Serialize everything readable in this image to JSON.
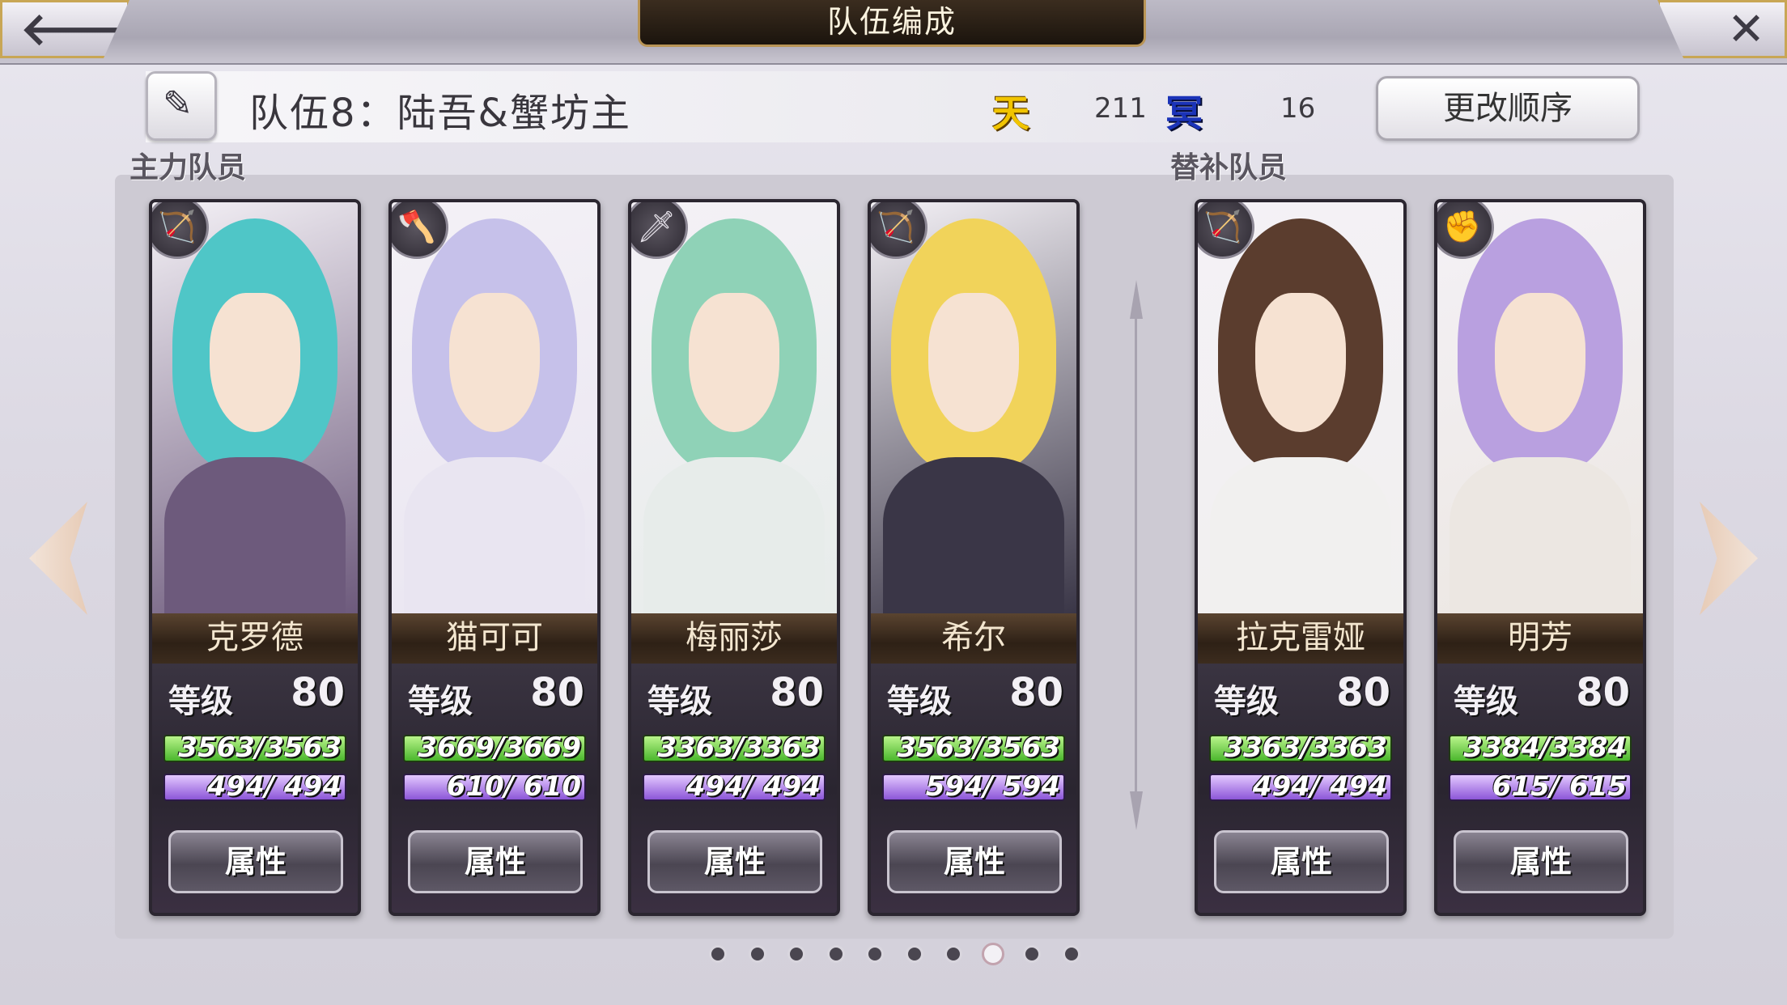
{
  "header": {
    "title": "队伍编成",
    "back_glyph": "🡐",
    "close_glyph": "✕"
  },
  "team": {
    "name": "队伍8：陆吾&蟹坊主",
    "sky_icon_label": "天",
    "sky_value": "211",
    "nether_icon_label": "冥",
    "nether_value": "16",
    "reorder_label": "更改顺序",
    "edit_icon": "pen-icon"
  },
  "sections": {
    "main_label": "主力队员",
    "sub_label": "替补队员"
  },
  "level_label": "等级",
  "attr_label": "属性",
  "characters": [
    {
      "name": "克罗德",
      "level": "80",
      "hp": "3563/3563",
      "mp": "494/ 494",
      "weapon": "bow-icon",
      "weapon_glyph": "🏹",
      "hair": "#4fc6c7",
      "body": "#6d5a7c"
    },
    {
      "name": "猫可可",
      "level": "80",
      "hp": "3669/3669",
      "mp": "610/ 610",
      "weapon": "axe-icon",
      "weapon_glyph": "🪓",
      "hair": "#c6c1ea",
      "body": "#e9e5f1"
    },
    {
      "name": "梅丽莎",
      "level": "80",
      "hp": "3363/3363",
      "mp": "494/ 494",
      "weapon": "sword-icon",
      "weapon_glyph": "🗡",
      "hair": "#8fd2b7",
      "body": "#e7ecea"
    },
    {
      "name": "希尔",
      "level": "80",
      "hp": "3563/3563",
      "mp": "594/ 594",
      "weapon": "bow-icon",
      "weapon_glyph": "🏹",
      "hair": "#f1d35a",
      "body": "#3a3647"
    },
    {
      "name": "拉克雷娅",
      "level": "80",
      "hp": "3363/3363",
      "mp": "494/ 494",
      "weapon": "bow-icon",
      "weapon_glyph": "🏹",
      "hair": "#5b3d2e",
      "body": "#f1f0ef"
    },
    {
      "name": "明芳",
      "level": "80",
      "hp": "3384/3384",
      "mp": "615/ 615",
      "weapon": "gauntlet-icon",
      "weapon_glyph": "✊",
      "hair": "#b9a0e0",
      "body": "#ece7e2"
    }
  ],
  "pagination": {
    "total": 10,
    "active_index": 7
  },
  "colors": {
    "hp": "#4bb72d",
    "mp": "#8c56d8",
    "sky": "#f1c400",
    "nether": "#1b33b8",
    "accent_gold": "#b99556"
  }
}
